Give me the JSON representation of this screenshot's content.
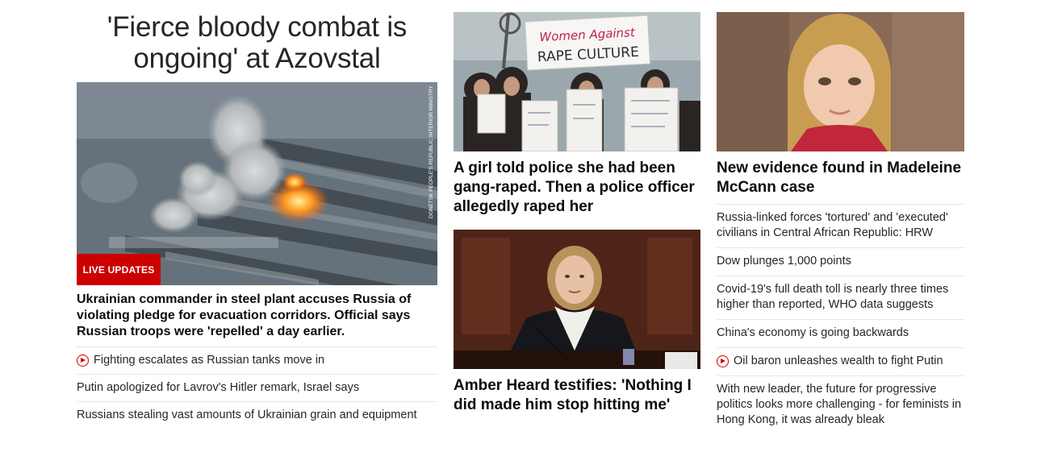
{
  "left_column": {
    "title": "'Fierce bloody combat is ongoing' at Azovstal",
    "badge": "LIVE UPDATES",
    "image_credit": "DONETSK PEOPLE'S REPUBLIC INTERIOR MINISTRY",
    "lead_headline": "Ukrainian commander in steel plant accuses Russia of violating pledge for evacuation corridors. Official says Russian troops were 'repelled' a day earlier.",
    "links": [
      {
        "text": "Fighting escalates as Russian tanks move in",
        "icon": "play-icon"
      },
      {
        "text": "Putin apologized for Lavrov's Hitler remark, Israel says"
      },
      {
        "text": "Russians stealing vast amounts of Ukrainian grain and equipment"
      }
    ]
  },
  "middle_column": {
    "stories": [
      {
        "title": "A girl told police she had been gang-raped. Then a police officer allegedly raped her",
        "image_sign": "Women Against RAPE CULTURE"
      },
      {
        "title": "Amber Heard testifies: 'Nothing I did made him stop hitting me'"
      }
    ]
  },
  "right_column": {
    "feature_title": "New evidence found in Madeleine McCann case",
    "links": [
      {
        "text": "Russia-linked forces 'tortured' and 'executed' civilians in Central African Republic: HRW"
      },
      {
        "text": "Dow plunges 1,000 points"
      },
      {
        "text": "Covid-19's full death toll is nearly three times higher than reported, WHO data suggests"
      },
      {
        "text": "China's economy is going backwards"
      },
      {
        "text": "Oil baron unleashes wealth to fight Putin",
        "icon": "play-icon"
      },
      {
        "text": "With new leader, the future for progressive politics looks more challenging - for feminists in Hong Kong, it was already bleak"
      }
    ]
  },
  "colors": {
    "accent": "#cc0000",
    "text": "#0c0c0c",
    "divider": "#e6e6e6"
  }
}
